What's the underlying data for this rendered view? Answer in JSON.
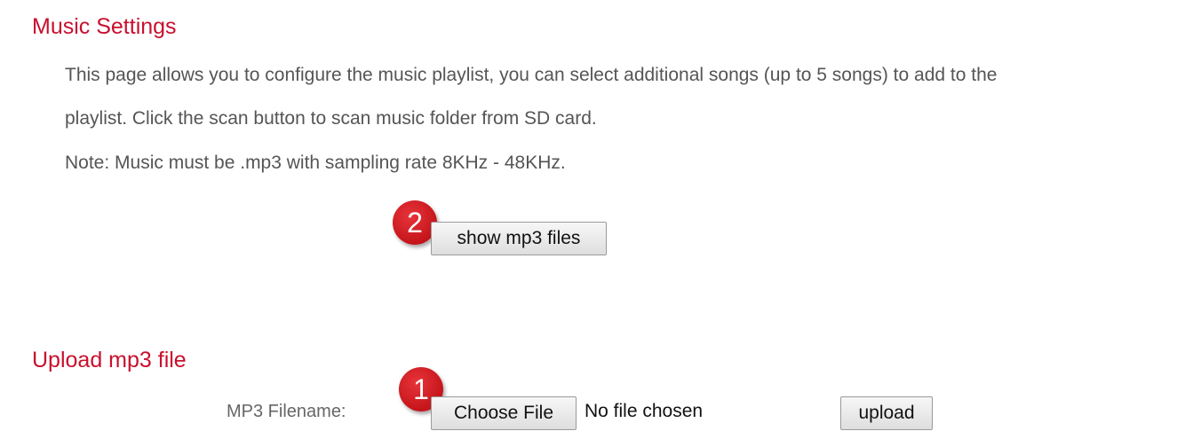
{
  "music_settings": {
    "title": "Music Settings",
    "description_line1": "This page allows you to configure the music playlist, you can select additional songs (up to 5 songs) to add to the",
    "description_line2": "playlist. Click the scan button to scan music folder from SD card.",
    "note": "Note: Music must be .mp3 with sampling rate 8KHz - 48KHz.",
    "show_button_label": "show mp3 files",
    "marker_label": "2"
  },
  "upload": {
    "title": "Upload mp3 file",
    "filename_label": "MP3 Filename:",
    "choose_button_label": "Choose File",
    "file_status": "No file chosen",
    "upload_button_label": "upload",
    "marker_label": "1"
  },
  "colors": {
    "title": "#c8102e",
    "marker": "#d41f25",
    "body_text": "#555555"
  }
}
